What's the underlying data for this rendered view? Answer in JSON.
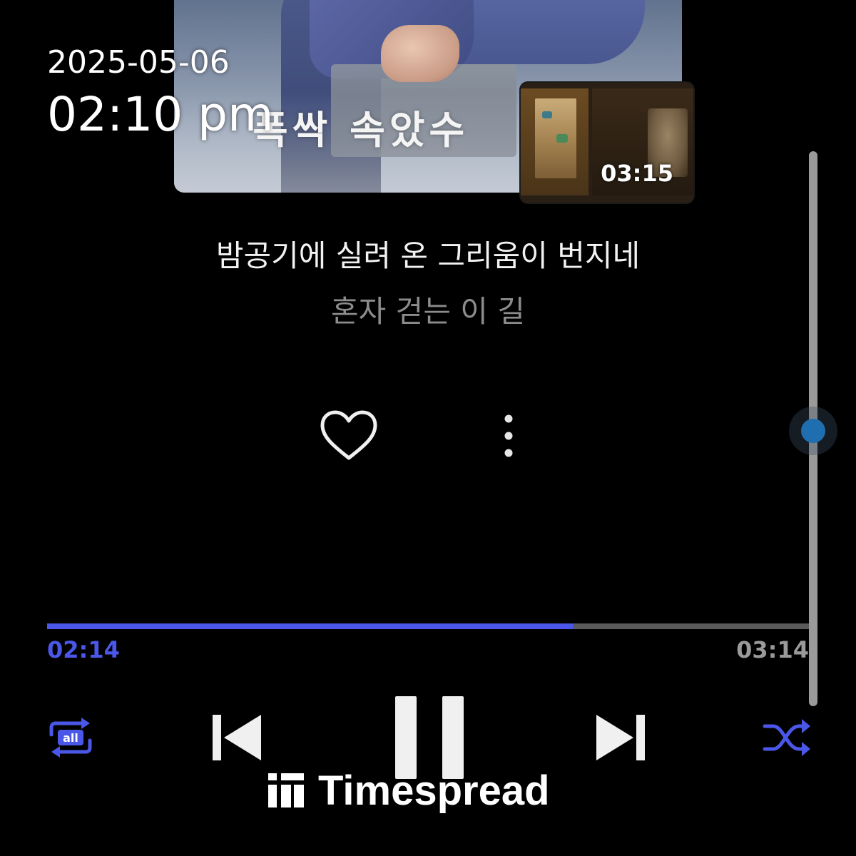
{
  "clock": {
    "date": "2025-05-06",
    "time": "02:10 pm"
  },
  "album": {
    "title_text": "폭싹 속았수"
  },
  "pip_video": {
    "time": "03:15"
  },
  "lyrics": {
    "current": "밤공기에 실려 온 그리움이 번지네",
    "next": "혼자 걷는 이 길"
  },
  "actions": {
    "like_icon": "heart-outline-icon",
    "more_icon": "more-vertical-icon"
  },
  "playback": {
    "elapsed": "02:14",
    "total": "03:14",
    "progress": 0.69,
    "accent_color": "#4a57e8"
  },
  "controls": {
    "repeat_icon": "repeat-all-icon",
    "repeat_label": "all",
    "prev_icon": "skip-previous-icon",
    "pause_icon": "pause-icon",
    "next_icon": "skip-next-icon",
    "shuffle_icon": "shuffle-icon"
  },
  "scrollbar": {
    "thumb_color": "#1f6fb0"
  },
  "watermark": {
    "brand": "Timespread"
  }
}
